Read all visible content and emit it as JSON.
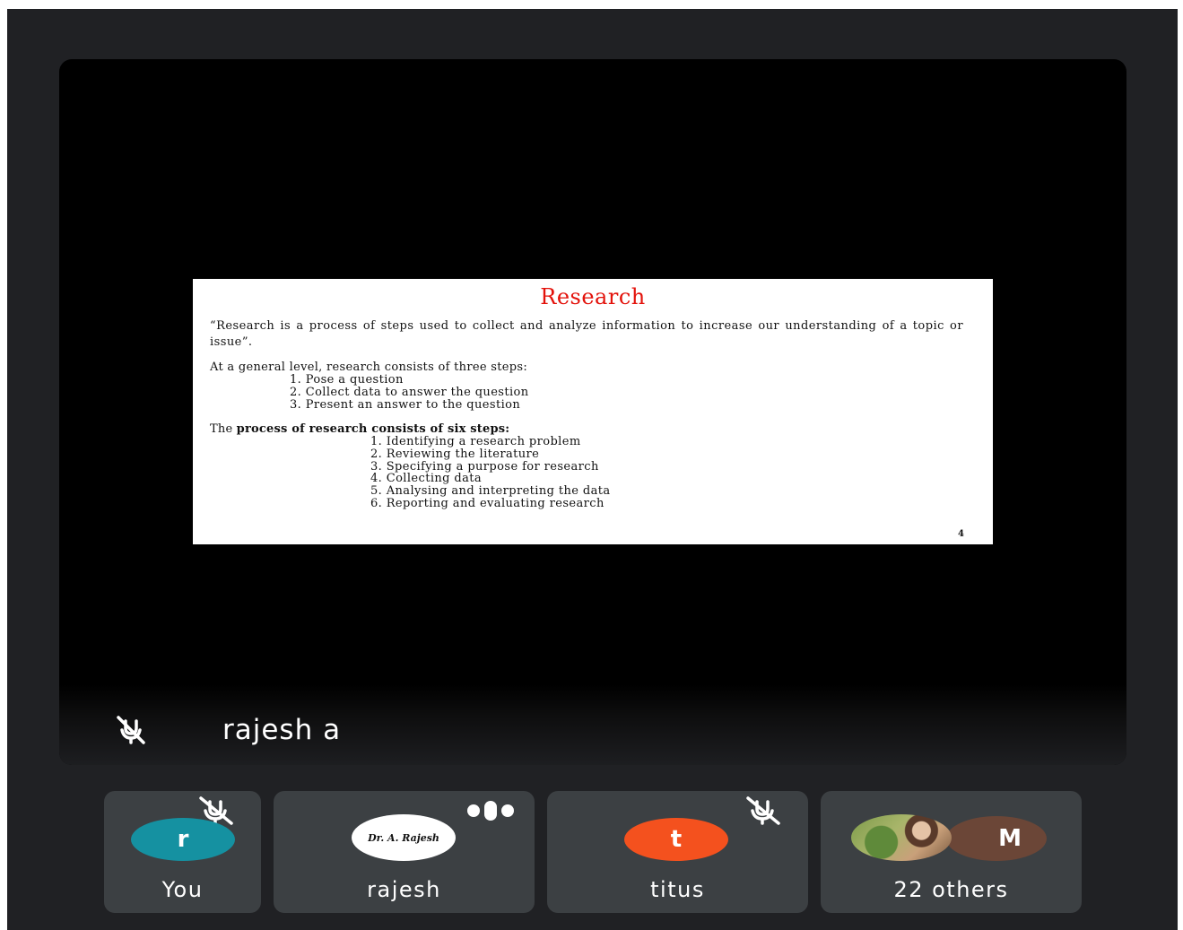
{
  "presenter": {
    "name": "rajesh a"
  },
  "slide": {
    "title": "Research",
    "definition": "“Research is a process of steps used to collect and analyze information to increase our understanding of a topic or issue”.",
    "general_intro": "At a general level, research consists of three steps:",
    "general_steps": [
      "1.  Pose a question",
      "2.  Collect data to answer the question",
      "3.  Present an answer to the question"
    ],
    "process_prefix": "The ",
    "process_bold": "process of research consists of six steps:",
    "process_steps": [
      "1. Identifying a research problem",
      "2. Reviewing the literature",
      "3. Specifying a purpose for research",
      "4. Collecting data",
      "5. Analysing and interpreting the data",
      "6. Reporting and evaluating research"
    ],
    "page_number": "4"
  },
  "participants": [
    {
      "label": "You",
      "initial": "r",
      "color": "#1591a1",
      "status_icon": "mic-off-icon"
    },
    {
      "label": "rajesh",
      "avatar_text": "Dr. A. Rajesh",
      "status_icon": "speaking-indicator-icon"
    },
    {
      "label": "titus",
      "initial": "t",
      "color": "#f4511e",
      "status_icon": "mic-off-icon"
    },
    {
      "label": "22 others",
      "initial": "M",
      "color": "#6b4637"
    }
  ]
}
